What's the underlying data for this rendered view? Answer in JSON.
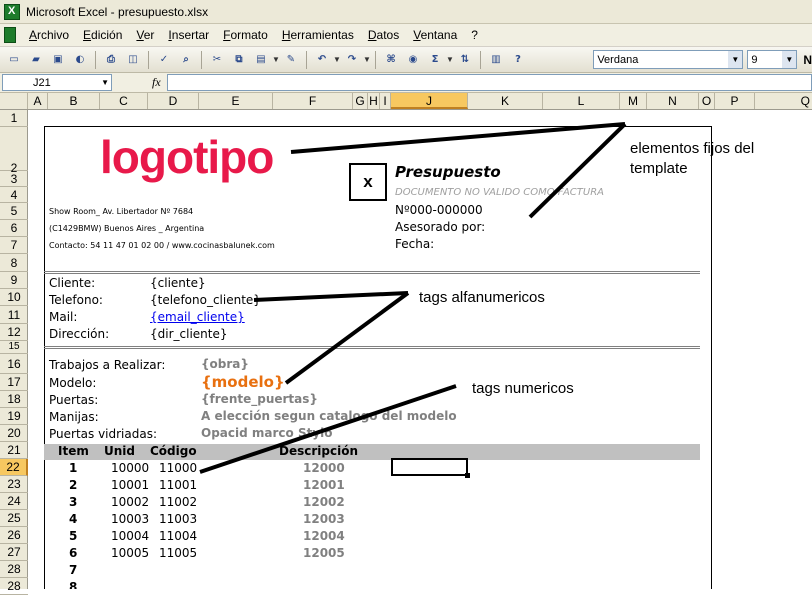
{
  "window": {
    "title": "Microsoft Excel - presupuesto.xlsx"
  },
  "menu": [
    "Archivo",
    "Edición",
    "Ver",
    "Insertar",
    "Formato",
    "Herramientas",
    "Datos",
    "Ventana",
    "?"
  ],
  "toolbar": {
    "font_name": "Verdana",
    "font_size": "9",
    "bold_label": "N"
  },
  "formula_bar": {
    "name_box": "J21",
    "fx": "fx",
    "formula": ""
  },
  "columns": [
    "A",
    "B",
    "C",
    "D",
    "E",
    "F",
    "G",
    "H",
    "I",
    "J",
    "K",
    "L",
    "M",
    "N",
    "O",
    "P",
    "Q"
  ],
  "rows": [
    "1",
    "2",
    "3",
    "4",
    "5",
    "6",
    "7",
    "8",
    "9",
    "10",
    "11",
    "12",
    "15",
    "16",
    "17",
    "18",
    "19",
    "20",
    "21",
    "22",
    "23",
    "24",
    "25",
    "26",
    "27",
    "28"
  ],
  "selected": {
    "column": "J",
    "row": "21"
  },
  "template": {
    "logo": "logotipo",
    "x_mark": "x",
    "doc_title": "Presupuesto",
    "doc_subtitle": "DOCUMENTO NO VALIDO COMO FACTURA",
    "doc_number": "Nº000-000000",
    "asesorado": "Asesorado por:",
    "fecha": "Fecha:",
    "address1": "Show Room_ Av. Libertador Nº 7684",
    "address2": "(C1429BMW) Buenos Aires _ Argentina",
    "address3": "Contacto: 54 11 47 01 02 00 / www.cocinasbalunek.com"
  },
  "client": {
    "labels": [
      "Cliente:",
      "Telefono:",
      "Mail:",
      "Dirección:"
    ],
    "tags": [
      "{cliente}",
      "{telefono_cliente}",
      "{email_cliente}",
      "{dir_cliente}"
    ]
  },
  "work": {
    "labels": [
      "Trabajos a Realizar:",
      "Modelo:",
      "Puertas:",
      "Manijas:",
      "Puertas vidriadas:"
    ],
    "values": [
      "{obra}",
      "{modelo}",
      "{frente_puertas}",
      "A elección segun catalogo del modelo",
      "Opacid marco Stylo"
    ]
  },
  "table": {
    "headers": [
      "Item",
      "Unid",
      "Código",
      "Descripción"
    ],
    "rows": [
      [
        "1",
        "10000",
        "11000",
        "12000"
      ],
      [
        "2",
        "10001",
        "11001",
        "12001"
      ],
      [
        "3",
        "10002",
        "11002",
        "12002"
      ],
      [
        "4",
        "10003",
        "11003",
        "12003"
      ],
      [
        "5",
        "10004",
        "11004",
        "12004"
      ],
      [
        "6",
        "10005",
        "11005",
        "12005"
      ],
      [
        "7",
        "",
        "",
        ""
      ],
      [
        "8",
        "",
        "",
        ""
      ]
    ]
  },
  "annotations": {
    "fixed_line1": "elementos fijos del",
    "fixed_line2": "template",
    "alnum": "tags alfanumericos",
    "numeric": "tags numericos"
  }
}
